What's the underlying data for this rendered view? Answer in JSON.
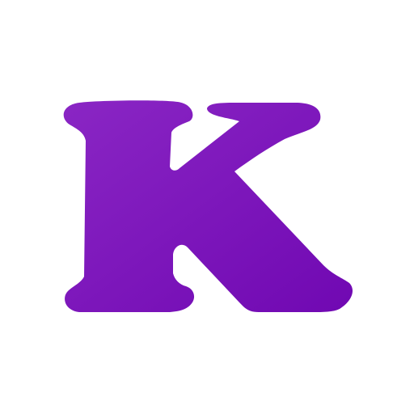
{
  "logo": {
    "letter": "K",
    "icon": "letter-k-logo-icon",
    "colors": {
      "gradient_start": "#8a26c4",
      "gradient_end": "#7008b2",
      "background": "#ffffff"
    }
  }
}
